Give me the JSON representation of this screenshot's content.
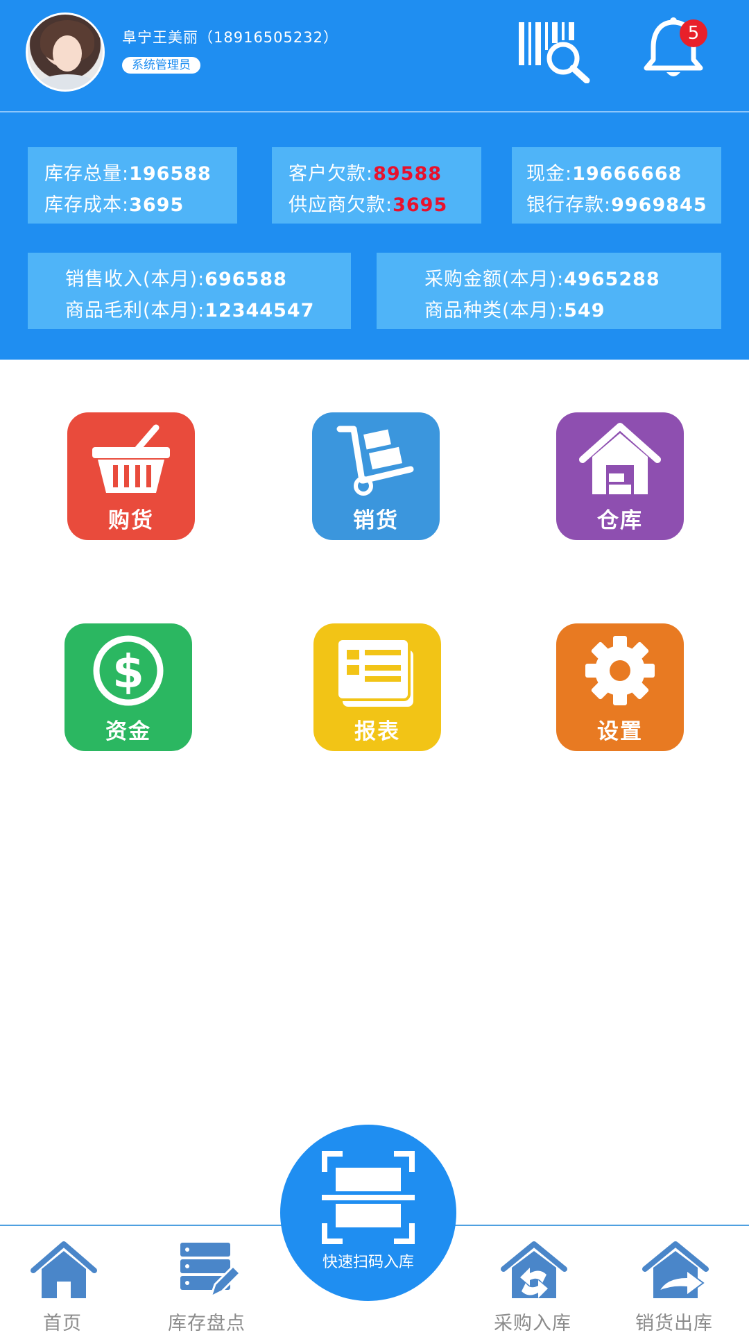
{
  "header": {
    "user_name": "阜宁王美丽（18916505232）",
    "role": "系统管理员",
    "notification_count": "5"
  },
  "stats": {
    "box1": {
      "label1": "库存总量:",
      "value1": "196588",
      "label2": "库存成本:",
      "value2": "3695"
    },
    "box2": {
      "label1": "客户欠款:",
      "value1": "89588",
      "label2": "供应商欠款:",
      "value2": "3695"
    },
    "box3": {
      "label1": "现金:",
      "value1": "19666668",
      "label2": "银行存款:",
      "value2": "9969845"
    },
    "box4": {
      "label1": "销售收入(本月):",
      "value1": "696588",
      "label2": "商品毛利(本月):",
      "value2": "12344547"
    },
    "box5": {
      "label1": "采购金额(本月):",
      "value1": "4965288",
      "label2": "商品种类(本月):",
      "value2": "549"
    }
  },
  "apps": {
    "purchase": "购货",
    "sales": "销货",
    "warehouse": "仓库",
    "funds": "资金",
    "reports": "报表",
    "settings": "设置"
  },
  "bottom_nav": {
    "home": "首页",
    "stocktake": "库存盘点",
    "quick_scan": "快速扫码入库",
    "purchase_in": "采购入库",
    "sales_out": "销货出库"
  },
  "colors": {
    "header_bg": "#1f8ef1",
    "stat_box_bg": "#4fb4f8",
    "highlight_red": "#e8112d",
    "purchase_tile": "#e94b3c",
    "sales_tile": "#3b96dd",
    "warehouse_tile": "#8e4fb0",
    "funds_tile": "#2bb761",
    "reports_tile": "#f2c416",
    "settings_tile": "#e87a22"
  }
}
